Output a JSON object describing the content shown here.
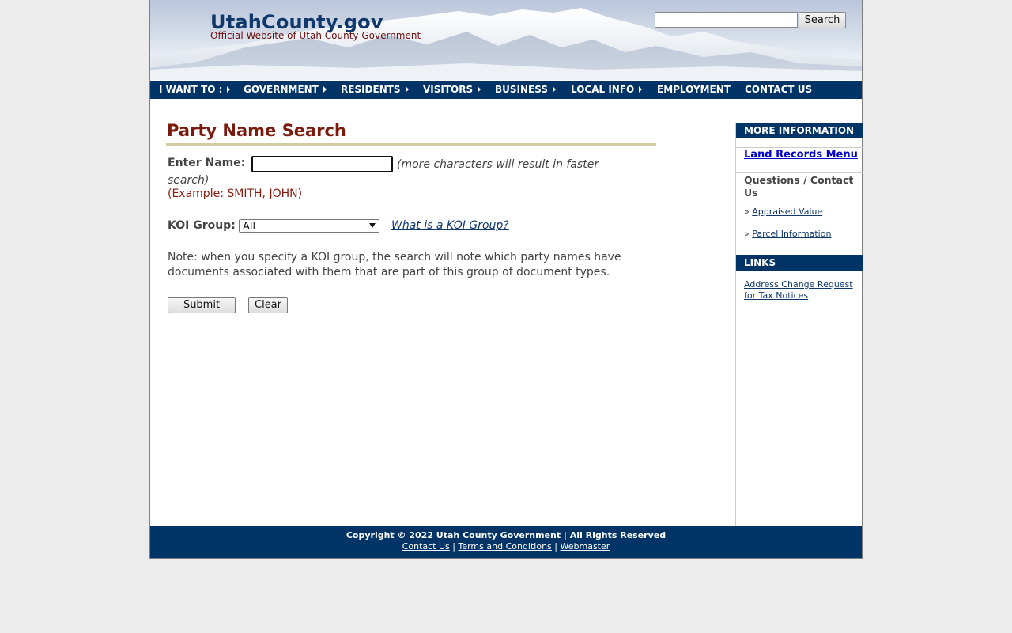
{
  "header": {
    "site_title": "UtahCounty.gov",
    "site_subtitle": "Official Website of Utah County Government",
    "search_value": "",
    "search_button": "Search"
  },
  "nav": {
    "items": [
      {
        "label": "I WANT TO :",
        "has_arrow": true
      },
      {
        "label": "GOVERNMENT",
        "has_arrow": true
      },
      {
        "label": "RESIDENTS",
        "has_arrow": true
      },
      {
        "label": "VISITORS",
        "has_arrow": true
      },
      {
        "label": "BUSINESS",
        "has_arrow": true
      },
      {
        "label": "LOCAL INFO",
        "has_arrow": true
      },
      {
        "label": "EMPLOYMENT",
        "has_arrow": false
      },
      {
        "label": "CONTACT US",
        "has_arrow": false
      }
    ]
  },
  "main": {
    "title": "Party Name Search",
    "name_label": "Enter Name:",
    "name_value": "",
    "name_hint": "(more characters will result in faster search)",
    "name_example": "(Example: SMITH, JOHN)",
    "koi_label": "KOI Group:",
    "koi_selected": "All",
    "koi_link": "What is a KOI Group?",
    "note": "Note: when you specify a KOI group, the search will note which party names have documents associated with them that are part of this group of document types.",
    "submit_label": "Submit",
    "clear_label": "Clear"
  },
  "sidebar": {
    "more_info_heading": "MORE INFORMATION",
    "land_records_link": "Land Records Menu",
    "questions_heading": "Questions / Contact Us",
    "bullet": "»",
    "appraised_value_link": "Appraised Value",
    "parcel_info_link": "Parcel Information",
    "links_heading": "LINKS",
    "address_change_link": "Address Change Request for Tax Notices"
  },
  "footer": {
    "copyright": "Copyright © 2022 Utah County Government | All Rights Reserved",
    "contact_link": "Contact Us",
    "terms_link": "Terms and Conditions",
    "webmaster_link": "Webmaster",
    "separator": "|"
  },
  "colors": {
    "navy": "#003366",
    "title_red": "#7a1a0c",
    "rule_tan": "#d3cba1"
  }
}
